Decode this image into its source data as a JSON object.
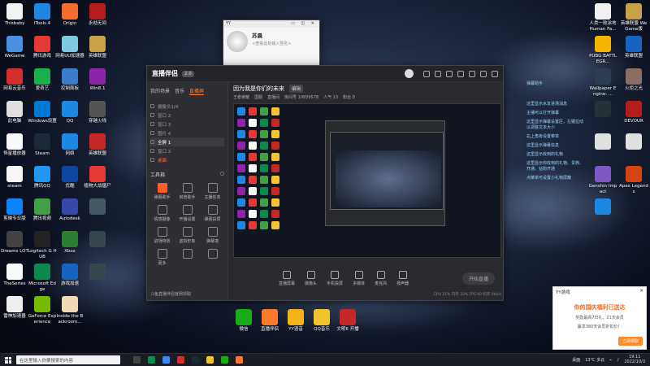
{
  "desktop": {
    "left_icons": [
      {
        "label": "Thisbaby",
        "color": "#f2f2f2"
      },
      {
        "label": "iTools 4",
        "color": "#1e88e5"
      },
      {
        "label": "Origin",
        "color": "#f56c2d"
      },
      {
        "label": "永劫无间",
        "color": "#b71c1c"
      },
      {
        "label": "WeGame",
        "color": "#4a90e2"
      },
      {
        "label": "腾讯游戏",
        "color": "#e53935"
      },
      {
        "label": "网易UU加速器",
        "color": "#7ec8e3"
      },
      {
        "label": "英雄联盟",
        "color": "#c9a14a"
      },
      {
        "label": "网易云音乐",
        "color": "#d32f2f"
      },
      {
        "label": "爱奇艺",
        "color": "#1ab04b"
      },
      {
        "label": "控制面板",
        "color": "#3d7cc9"
      },
      {
        "label": "Win8.1",
        "color": "#8e24aa"
      },
      {
        "label": "此电脑",
        "color": "#e0e0e0"
      },
      {
        "label": "Windows设置",
        "color": "#0078d4"
      },
      {
        "label": "QQ",
        "color": "#1e88e5"
      },
      {
        "label": "穿越火线",
        "color": "#555555"
      },
      {
        "label": "恒星播放器",
        "color": "#fafafa"
      },
      {
        "label": "Steam",
        "color": "#1b2838"
      },
      {
        "label": "网络",
        "color": "#1e88e5"
      },
      {
        "label": "英雄联盟",
        "color": "#c62828"
      },
      {
        "label": "steam",
        "color": "#f5f5f5"
      },
      {
        "label": "腾讯QQ",
        "color": "#2196f3"
      },
      {
        "label": "优酷",
        "color": "#0d47a1"
      },
      {
        "label": "植物大战僵尸",
        "color": "#e53935"
      },
      {
        "label": "剪映专业版",
        "color": "#0a84ff"
      },
      {
        "label": "腾讯视频",
        "color": "#43a047"
      },
      {
        "label": "Autodesk",
        "color": "#3949ab"
      },
      {
        "label": "",
        "color": "#455a64"
      },
      {
        "label": "Dreams LOT",
        "color": "#424242"
      },
      {
        "label": "Logitech G HUB",
        "color": "#222222"
      },
      {
        "label": "Xbox",
        "color": "#2e7d32"
      },
      {
        "label": "",
        "color": "#37474f"
      },
      {
        "label": "TheSeries",
        "color": "#fafafa"
      },
      {
        "label": "Microsoft Edge",
        "color": "#0b8a4c"
      },
      {
        "label": "游戏加速",
        "color": "#1565c0"
      },
      {
        "label": "",
        "color": "#37474f"
      },
      {
        "label": "雷神加速器",
        "color": "#eeeeee"
      },
      {
        "label": "GeForce Experience",
        "color": "#76b900"
      },
      {
        "label": "Inside the Backroom...",
        "color": "#f0d9b5"
      }
    ],
    "right_icons": [
      {
        "label": "人类一败涂地 Human Fa...",
        "color": "#f0f0f0"
      },
      {
        "label": "英雄联盟 WeGame版",
        "color": "#c9a14a"
      },
      {
        "label": "PUBG BATTLEGR...",
        "color": "#f4b400"
      },
      {
        "label": "英雄联盟",
        "color": "#1565c0"
      },
      {
        "label": "Wallpaper Engine: ...",
        "color": "#2c3e50"
      },
      {
        "label": "火炬之光",
        "color": "#8d6e63"
      },
      {
        "label": "",
        "color": "#263238"
      },
      {
        "label": "DEVOUR",
        "color": "#b71c1c"
      },
      {
        "label": "",
        "color": "#e0e0e0"
      },
      {
        "label": "",
        "color": "#e0e0e0"
      },
      {
        "label": "Genshin Impact",
        "color": "#7e57c2"
      },
      {
        "label": "Apex Legends",
        "color": "#d84315"
      },
      {
        "label": "",
        "color": "#1e88e5"
      }
    ],
    "bottom_icons": [
      {
        "label": "微信",
        "color": "#1aad19"
      },
      {
        "label": "直播伴侣",
        "color": "#ff7a2e"
      },
      {
        "label": "YY语音",
        "color": "#f5b31c"
      },
      {
        "label": "QQ音乐",
        "color": "#f4c430"
      },
      {
        "label": "文明6 开播",
        "color": "#c62828"
      }
    ]
  },
  "yy_popup": {
    "title": "YY",
    "controls": "▭ ◫ ✕",
    "name": "苏晨",
    "signature": "<查看此处输入签名>"
  },
  "main_window": {
    "app_name": "直播伴侣",
    "version": "2.0",
    "left_tabs": [
      "我的场景",
      "音乐",
      "直播屏"
    ],
    "active_left_tab": "直播屏",
    "scenes": [
      {
        "label": "摄像头1/4",
        "selected": false,
        "red": false
      },
      {
        "label": "窗口 2",
        "selected": false,
        "red": false
      },
      {
        "label": "窗口 3",
        "selected": false,
        "red": false
      },
      {
        "label": "图片 4",
        "selected": false,
        "red": false
      },
      {
        "label": "全屏 1",
        "selected": true,
        "red": false
      },
      {
        "label": "窗口 2",
        "selected": false,
        "red": false
      },
      {
        "label": "桌面",
        "selected": false,
        "red": true
      }
    ],
    "tools_title": "工具箱",
    "tools": [
      {
        "label": "弹幕助手",
        "hl": true
      },
      {
        "label": "房管助手",
        "hl": false
      },
      {
        "label": "主播任务",
        "hl": false
      },
      {
        "label": "情感摄像",
        "hl": false
      },
      {
        "label": "开播设置",
        "hl": false
      },
      {
        "label": "弹幕投屏",
        "hl": false
      },
      {
        "label": "进场特效",
        "hl": false
      },
      {
        "label": "虚拟形象",
        "hl": false
      },
      {
        "label": "弹幕墙",
        "hl": false
      },
      {
        "label": "更多",
        "hl": false
      },
      {
        "label": "",
        "hl": false
      },
      {
        "label": "",
        "hl": false
      }
    ],
    "left_footer": "斗鱼直播伴侣官网领取",
    "stream_title": "因为我是你们的未来",
    "stream_tag": "编辑",
    "sub_info": [
      "王者荣耀",
      "国服",
      "直播间",
      "房间号 10839578",
      "人气 13",
      "粉丝 0"
    ],
    "controls": [
      {
        "label": "直播屏幕"
      },
      {
        "label": "摄像头"
      },
      {
        "label": "手机投屏"
      },
      {
        "label": "多媒体"
      },
      {
        "label": "麦克风"
      },
      {
        "label": "扬声器"
      }
    ],
    "start_button": "开始直播",
    "status": "CPU 21%  内存 33%  FPS 60  码率 0kb/s"
  },
  "chat_lines": [
    "弹幕助手",
    "这里显示水友进场消息",
    "主播可以打开弹幕",
    "这里显示弹幕设置区，左键拉动以调整文本大小",
    "右上角有设置菜单",
    "这里显示弹幕信息",
    "这里显示收到的礼物",
    "这里显示你收到的礼物、贵族、开通、钻粉开通",
    "点菜单可设置小礼物屏蔽"
  ],
  "notification": {
    "app": "YY游戏",
    "close": "✕",
    "title": "你的国庆福利已送达",
    "line1": "奖励最高7日礼，21天会员",
    "line2": "赢享380天会员折扣价！",
    "button": "立即领取"
  },
  "taskbar": {
    "search_placeholder": "在这里输入你要搜索的内容",
    "tray_text": "桌面",
    "weather": "13°C 多云",
    "time": "19:11",
    "date": "2022/10/3"
  }
}
